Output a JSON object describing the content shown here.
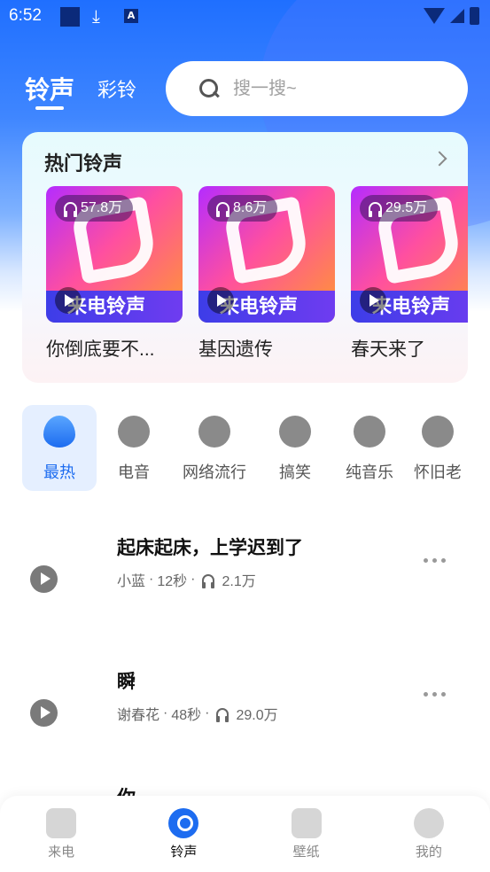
{
  "status_bar": {
    "time": "6:52"
  },
  "top_tabs": {
    "ringtone": "铃声",
    "color_ring": "彩铃"
  },
  "search": {
    "placeholder": "搜一搜~"
  },
  "hot": {
    "title": "热门铃声",
    "cards": [
      {
        "plays": "57.8万",
        "banner": "来电铃声",
        "title": "你倒底要不..."
      },
      {
        "plays": "8.6万",
        "banner": "来电铃声",
        "title": "基因遗传"
      },
      {
        "plays": "29.5万",
        "banner": "来电铃声",
        "title": "春天来了"
      }
    ]
  },
  "categories": [
    {
      "label": "最热",
      "icon": "flame-icon",
      "active": true
    },
    {
      "label": "电音",
      "icon": "lightning-icon"
    },
    {
      "label": "网络流行",
      "icon": "microphone-icon"
    },
    {
      "label": "搞笑",
      "icon": "laugh-face-icon"
    },
    {
      "label": "纯音乐",
      "icon": "music-note-icon"
    },
    {
      "label": "怀旧老",
      "icon": "vinyl-disc-icon"
    }
  ],
  "songs": [
    {
      "title": "起床起床，上学迟到了",
      "artist": "小蓝",
      "duration": "12秒",
      "plays": "2.1万"
    },
    {
      "title": "瞬",
      "artist": "谢春花",
      "duration": "48秒",
      "plays": "29.0万"
    },
    {
      "title": "你"
    }
  ],
  "bottom_nav": [
    {
      "label": "来电",
      "icon": "phone-call-icon"
    },
    {
      "label": "铃声",
      "icon": "music-disc-icon",
      "active": true
    },
    {
      "label": "壁纸",
      "icon": "image-icon"
    },
    {
      "label": "我的",
      "icon": "profile-face-icon"
    }
  ],
  "colors": {
    "accent": "#1d6cf0",
    "header_blue": "#2f78ff"
  }
}
